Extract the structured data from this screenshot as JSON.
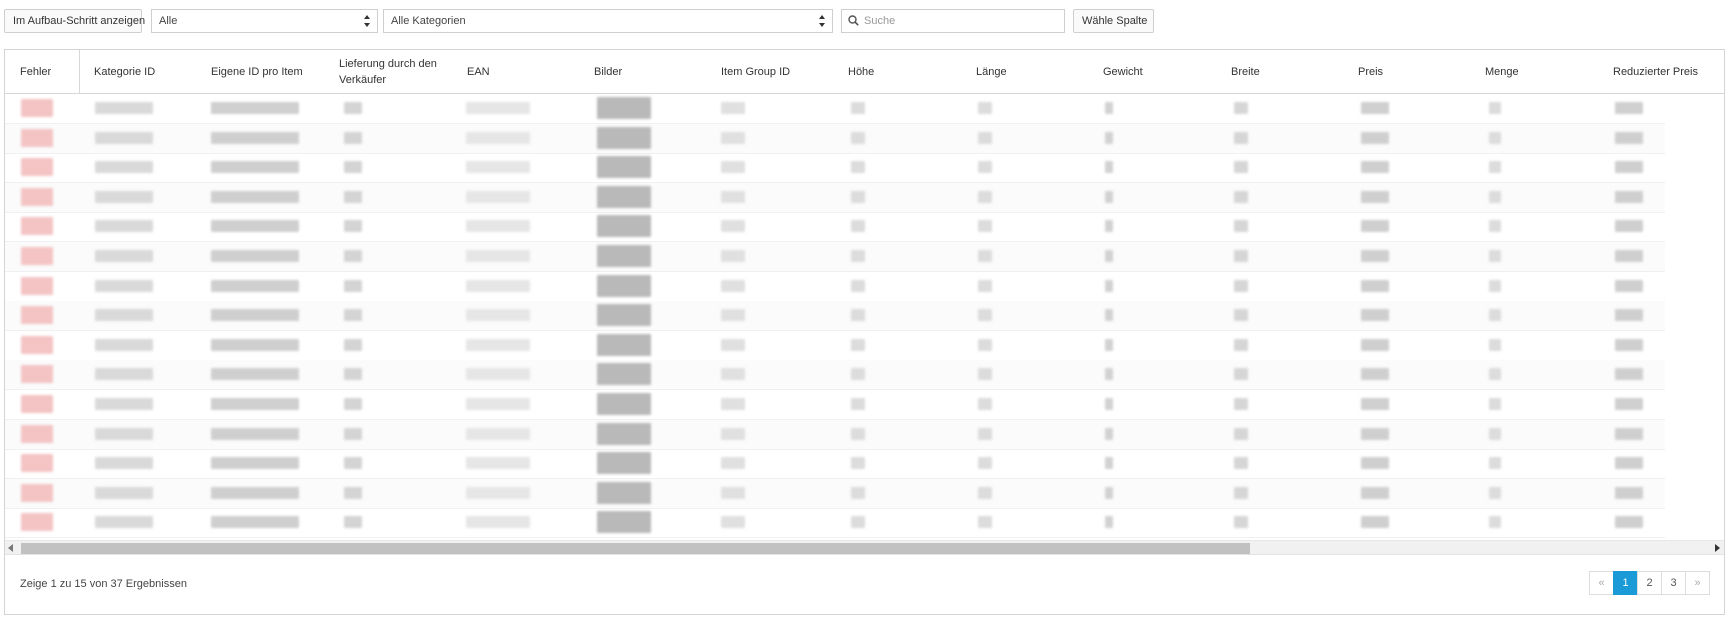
{
  "toolbar": {
    "build_step_button": "Im Aufbau-Schritt anzeigen",
    "status_select": "Alle",
    "category_select": "Alle Kategorien",
    "search_placeholder": "Suche",
    "choose_column_button": "Wähle Spalte"
  },
  "table": {
    "columns": [
      "Fehler",
      "Kategorie ID",
      "Eigene ID pro Item",
      "Lieferung durch den Verkäufer",
      "EAN",
      "Bilder",
      "Item Group ID",
      "Höhe",
      "Länge",
      "Gewicht",
      "Breite",
      "Preis",
      "Menge",
      "Reduzierter Preis"
    ]
  },
  "footer": {
    "results_text": "Zeige 1 zu 15 von 37 Ergebnissen",
    "pagination": {
      "prev": "«",
      "pages": [
        "1",
        "2",
        "3"
      ],
      "active": "1",
      "next": "»"
    }
  },
  "colors": {
    "accent": "#1a9bd7",
    "error_blur": "#f4c4c4"
  }
}
